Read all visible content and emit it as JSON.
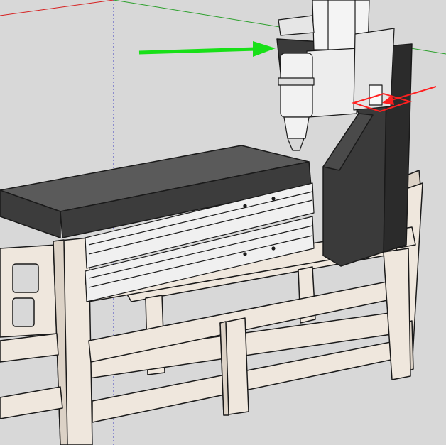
{
  "scene": {
    "kind": "3d-model-viewport",
    "colors": {
      "background": "#d8d8d8",
      "frame_light": "#efe7dd",
      "frame_shade": "#dcd2c6",
      "frame_edge": "#1a1a1a",
      "granite_top": "#5a5a5a",
      "granite_side": "#3c3c3c",
      "column_front": "#3a3a3a",
      "column_side": "#2b2b2b",
      "rail_light": "#f0f0f0",
      "spindle_body": "#f2f2f2",
      "axis_red": "#d62020",
      "axis_green": "#2ca02c",
      "axis_blue": "#4040c0",
      "pointer_green": "#18e018",
      "pointer_red": "#ff2020"
    },
    "annotations": [
      {
        "name": "green-arrow",
        "color": "#18e018",
        "points_to": "gantry-column-top"
      },
      {
        "name": "red-arrow",
        "color": "#ff2020",
        "points_to": "red-highlight-box"
      }
    ]
  }
}
